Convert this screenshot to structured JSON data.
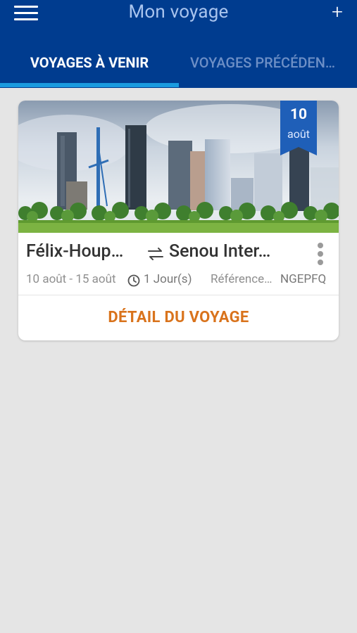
{
  "header": {
    "title": "Mon voyage",
    "add_icon": "+",
    "menu_icon": "hamburger-menu-icon",
    "background_color": "#003c8f"
  },
  "tabs": [
    {
      "label": "VOYAGES À VENIR",
      "active": true
    },
    {
      "label": "VOYAGES PRÉCÉDEN…",
      "active": false
    }
  ],
  "trip": {
    "badge_day": "10",
    "badge_month": "août",
    "origin": "Félix-Houp…",
    "destination": "Senou Inter…",
    "dates": "10 août - 15 août",
    "duration": "1 Jour(s)",
    "reference_label": "Référence…",
    "reference_value": "NGEPFQ",
    "detail_button": "DÉTAIL DU VOYAGE",
    "accent_color": "#d9731c"
  }
}
